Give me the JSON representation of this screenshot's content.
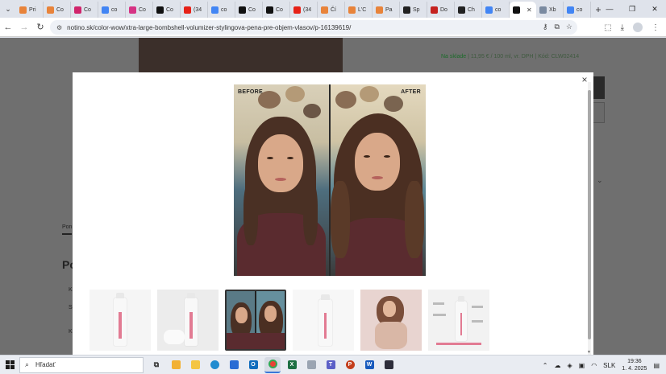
{
  "browser": {
    "tabs": [
      {
        "label": "Pri",
        "icon": "orange-pen-icon",
        "color": "#e8833a"
      },
      {
        "label": "Co",
        "icon": "orange-pen-icon",
        "color": "#e8833a"
      },
      {
        "label": "Co",
        "icon": "magenta-logo-icon",
        "color": "#d0246b"
      },
      {
        "label": "co",
        "icon": "google-icon",
        "color": "#4285f4"
      },
      {
        "label": "Co",
        "icon": "pink-p-icon",
        "color": "#d63384"
      },
      {
        "label": "Co",
        "icon": "notino-n-icon",
        "color": "#111111"
      },
      {
        "label": "(34",
        "icon": "youtube-icon",
        "color": "#e62117"
      },
      {
        "label": "co",
        "icon": "google-icon",
        "color": "#4285f4"
      },
      {
        "label": "Co",
        "icon": "notino-n-icon",
        "color": "#111111"
      },
      {
        "label": "Co",
        "icon": "notino-n-icon",
        "color": "#111111"
      },
      {
        "label": "(34",
        "icon": "youtube-icon",
        "color": "#e62117"
      },
      {
        "label": "Čí",
        "icon": "orange-pen-icon",
        "color": "#e8833a"
      },
      {
        "label": "L'C",
        "icon": "orange-pen-icon",
        "color": "#e8833a"
      },
      {
        "label": "Pa",
        "icon": "orange-pen-icon",
        "color": "#e8833a"
      },
      {
        "label": "Sp",
        "icon": "dark-square-icon",
        "color": "#222222"
      },
      {
        "label": "Do",
        "icon": "gmail-icon",
        "color": "#c5221f"
      },
      {
        "label": "Ch",
        "icon": "chatgpt-icon",
        "color": "#222222"
      },
      {
        "label": "co",
        "icon": "google-icon",
        "color": "#4285f4"
      },
      {
        "label": "",
        "icon": "notino-n-icon",
        "color": "#111111",
        "active": true
      },
      {
        "label": "Xb",
        "icon": "translate-icon",
        "color": "#7a8aa0"
      },
      {
        "label": "co",
        "icon": "google-icon",
        "color": "#4285f4"
      }
    ],
    "url": "notino.sk/color-wow/xtra-large-bombshell-volumizer-stylingova-pena-pre-objem-vlasov/p-16139619/"
  },
  "page": {
    "stock_status": "Na sklade",
    "stock_detail": " | 11,95 € / 100 ml, vr. DPH | Kód: CLW02414",
    "side_tab": "Pon",
    "side_heading": "Po"
  },
  "modal": {
    "before_label": "BEFORE",
    "after_label": "AFTER",
    "close_symbol": "×",
    "selected_thumbnail": 3,
    "thumbnail_count": 6
  },
  "taskbar": {
    "search_placeholder": "Hľadať",
    "language": "SLK",
    "time": "19:36",
    "date": "1. 4. 2025"
  }
}
